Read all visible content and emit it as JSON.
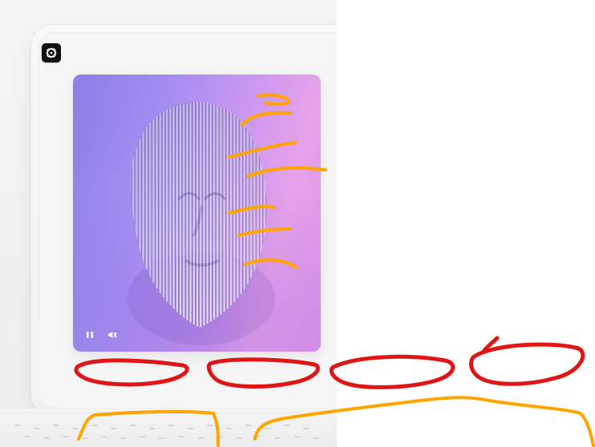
{
  "page": {
    "background": "#ffffff"
  },
  "device": {
    "frame_color": "#f4f4f4",
    "bezel_color": "#f6f6f6",
    "border_color": "#e6e6e6"
  },
  "app": {
    "logo_icon": "app-logo-icon",
    "logo_bg": "#111111"
  },
  "media": {
    "subject": "ribbed-face-sculpture",
    "gradient": [
      "#8b7fe6",
      "#a48cf0",
      "#d29af0",
      "#e7a2e9",
      "#d990eb"
    ],
    "controls": {
      "pause_icon": "pause-icon",
      "mute_icon": "mute-icon",
      "state": "playing",
      "muted": true
    }
  },
  "annotations": {
    "orange": "#ffa500",
    "red": "#e01616",
    "red_ellipses": 4,
    "orange_strokes_on_image": 6,
    "orange_brackets_bottom": 2
  }
}
